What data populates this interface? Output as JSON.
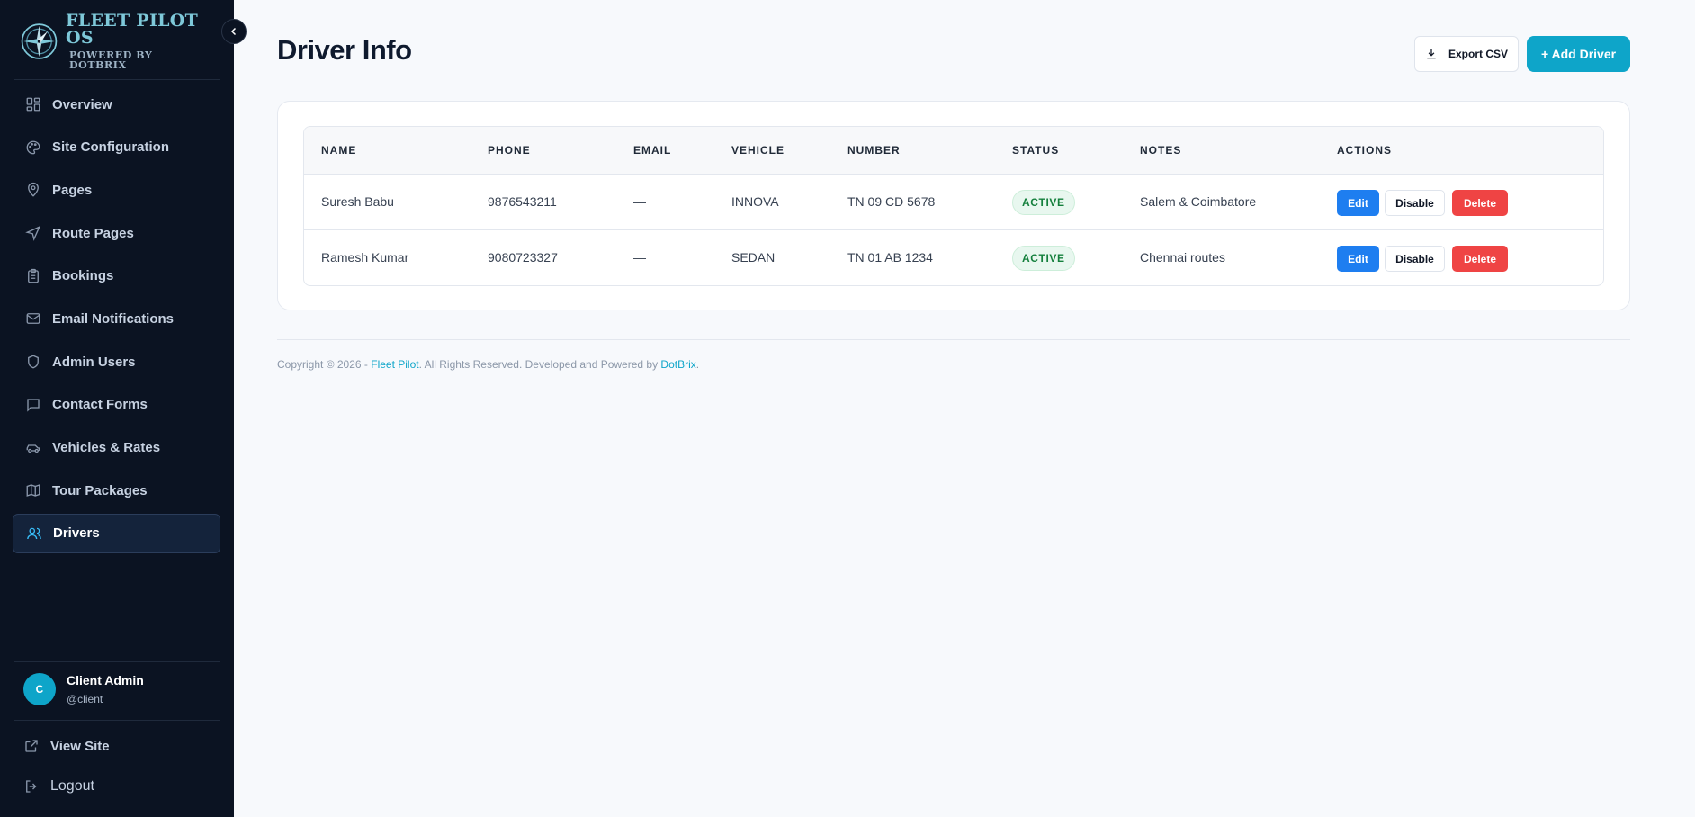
{
  "brand": {
    "title": "FLEET PILOT OS",
    "subtitle": "POWERED BY DOTBRIX"
  },
  "sidebar": {
    "items": [
      {
        "label": "Overview",
        "icon": "grid-icon"
      },
      {
        "label": "Site Configuration",
        "icon": "palette-icon"
      },
      {
        "label": "Pages",
        "icon": "map-pin-icon"
      },
      {
        "label": "Route Pages",
        "icon": "navigation-icon"
      },
      {
        "label": "Bookings",
        "icon": "clipboard-icon"
      },
      {
        "label": "Email Notifications",
        "icon": "mail-icon"
      },
      {
        "label": "Admin Users",
        "icon": "shield-icon"
      },
      {
        "label": "Contact Forms",
        "icon": "message-icon"
      },
      {
        "label": "Vehicles & Rates",
        "icon": "car-icon"
      },
      {
        "label": "Tour Packages",
        "icon": "map-icon"
      },
      {
        "label": "Drivers",
        "icon": "users-icon",
        "active": true
      }
    ],
    "user": {
      "initial": "C",
      "name": "Client Admin",
      "handle": "@client"
    },
    "view_site": "View Site",
    "logout": "Logout"
  },
  "header": {
    "title": "Driver Info",
    "export_label": "Export CSV",
    "add_label": "+ Add Driver"
  },
  "table": {
    "columns": [
      "NAME",
      "PHONE",
      "EMAIL",
      "VEHICLE",
      "NUMBER",
      "STATUS",
      "NOTES",
      "ACTIONS"
    ],
    "rows": [
      {
        "name": "Suresh Babu",
        "phone": "9876543211",
        "email": "—",
        "vehicle": "INNOVA",
        "number": "TN 09 CD 5678",
        "status": "ACTIVE",
        "notes": "Salem & Coimbatore"
      },
      {
        "name": "Ramesh Kumar",
        "phone": "9080723327",
        "email": "—",
        "vehicle": "SEDAN",
        "number": "TN 01 AB 1234",
        "status": "ACTIVE",
        "notes": "Chennai routes"
      }
    ],
    "actions": {
      "edit": "Edit",
      "disable": "Disable",
      "delete": "Delete"
    }
  },
  "footer": {
    "prefix": "Copyright © 2026 - ",
    "brand_link": "Fleet Pilot",
    "middle": ". All Rights Reserved. Developed and Powered by ",
    "dev_link": "DotBrix",
    "suffix": "."
  },
  "colors": {
    "accent": "#0ea5c9",
    "sidebar_bg": "#0b1322",
    "edit": "#1e7ef0",
    "delete": "#ef4444",
    "active_badge": "#15803d"
  }
}
